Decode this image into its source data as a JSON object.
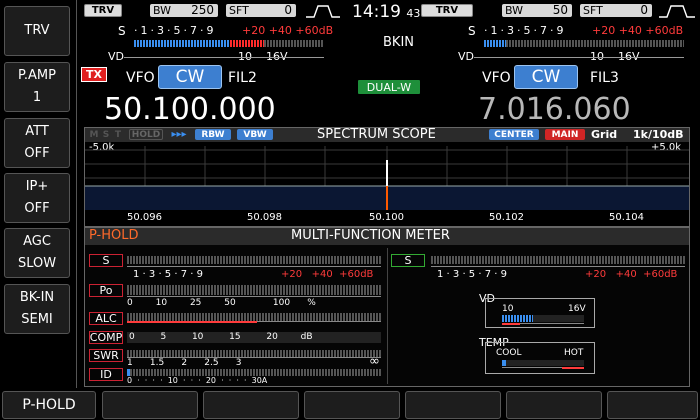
{
  "softkeys_left": [
    {
      "line1": "TRV",
      "line2": ""
    },
    {
      "line1": "P.AMP",
      "line2": "1"
    },
    {
      "line1": "ATT",
      "line2": "OFF"
    },
    {
      "line1": "IP+",
      "line2": "OFF"
    },
    {
      "line1": "AGC",
      "line2": "SLOW"
    },
    {
      "line1": "BK-IN",
      "line2": "SEMI"
    }
  ],
  "softkeys_bottom": [
    "P-HOLD",
    "",
    "",
    "",
    "",
    "",
    ""
  ],
  "top": {
    "clock": "14:19",
    "clock_sec": "43",
    "bkin": "BKIN",
    "left": {
      "trv": "TRV",
      "bw_label": "BW",
      "bw_value": "250",
      "sft_label": "SFT",
      "sft_value": "0"
    },
    "right": {
      "trv": "TRV",
      "bw_label": "BW",
      "bw_value": "50",
      "sft_label": "SFT",
      "sft_value": "0"
    }
  },
  "smeter_scale": {
    "s": "S",
    "marks": "·1·3·5·7·9",
    "over": "+20 +40 +60dB",
    "vd": "VD",
    "vd_marks": "10    16V"
  },
  "vfo_main": {
    "tx": "TX",
    "vfo": "VFO",
    "mode": "CW",
    "filter": "FIL2",
    "freq": "50.100.000"
  },
  "vfo_sub": {
    "vfo": "VFO",
    "mode": "CW",
    "filter": "FIL3",
    "freq": "7.016.060"
  },
  "dualw": "DUAL-W",
  "scope": {
    "chips_left": [
      "M",
      "S",
      "T"
    ],
    "hold": "HOLD",
    "arrows": "▸▸▸",
    "rbw": "RBW",
    "vbw": "VBW",
    "title": "SPECTRUM SCOPE",
    "center": "CENTER",
    "main": "MAIN",
    "grid": "Grid",
    "ref": "1k/10dB",
    "span_left": "-5.0k",
    "span_right": "+5.0k",
    "freq_labels": [
      "50.096",
      "50.098",
      "50.100",
      "50.102",
      "50.104"
    ]
  },
  "mfm": {
    "phold": "P-HOLD",
    "title": "MULTI-FUNCTION METER",
    "meters": [
      {
        "label": "S",
        "scale": "1 · 3 · 5 · 7 · 9",
        "scale_red": "+20   +40  +60dB"
      },
      {
        "label": "Po",
        "scale": "0        10        25        50             100      %",
        "scale_red": ""
      },
      {
        "label": "ALC",
        "scale": "",
        "scale_red": ""
      },
      {
        "label": "COMP",
        "scale": "0         5         10         15         20        dB",
        "scale_red": ""
      },
      {
        "label": "SWR",
        "scale": "1      1.5      2      2.5      3",
        "scale_red": ""
      },
      {
        "label": "ID",
        "scale": "0  ·  ·  ·  ·  10  ·  ·  ·  20  ·  ·  ·  ·  30A",
        "scale_red": ""
      }
    ],
    "right_s": {
      "label": "S",
      "scale": "1 · 3 · 5 · 7 · 9",
      "scale_red": "+20   +40  +60dB"
    },
    "vd_panel": {
      "title": "VD",
      "lo": "10",
      "hi": "16V",
      "level": 0.38
    },
    "temp_panel": {
      "title": "TEMP",
      "lo": "COOL",
      "hi": "HOT",
      "level": 0.05
    },
    "swr_infinity": "∞"
  },
  "colors": {
    "accent_blue": "#3d7fd0",
    "red": "#ff3b3b",
    "green": "#2db34a"
  }
}
